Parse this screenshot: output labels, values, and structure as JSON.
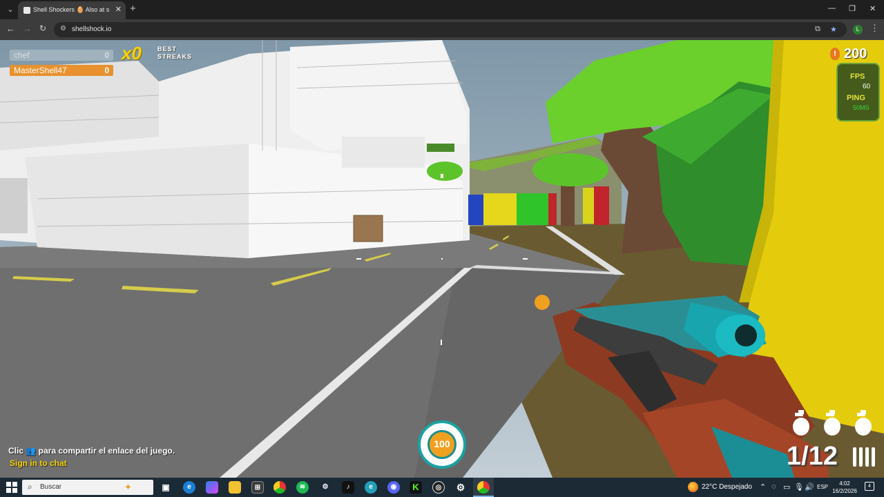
{
  "browser": {
    "tab_title": "Shell Shockers 🥚 Also at shell...",
    "tab_close": "✕",
    "new_tab": "+",
    "url": "shellshock.io",
    "profile_initial": "L",
    "window_controls": [
      "—",
      "❐",
      "✕"
    ]
  },
  "hud": {
    "scoreboard": [
      {
        "name": "chef",
        "score": "0"
      },
      {
        "name": "MasterShell47",
        "score": "0"
      }
    ],
    "streak_multiplier": "x0",
    "streak_label_line1": "BEST",
    "streak_label_line2": "STREAKS",
    "eggs_icon": "!",
    "eggs": "200",
    "fps_label": "FPS",
    "fps_value": "60",
    "ping_label": "PING",
    "ping_value": "50MS",
    "health": "100",
    "ammo": "1/12",
    "grenades": 3,
    "share_prefix": "Clic",
    "share_icon": "👥",
    "share_suffix": "para compartir el enlace del juego.",
    "sign_in": "Sign in to chat"
  },
  "colors": {
    "accent_orange": "#e8912e",
    "streak_yellow": "#f5d20a",
    "fps_yellow": "#e5e23b",
    "ping_green": "#3cd33c",
    "health_teal": "#1aa3a3"
  },
  "taskbar": {
    "search_placeholder": "Buscar",
    "weather": "22°C  Despejado",
    "language": "ESP",
    "time": "4:02",
    "date": "16/2/2026",
    "notification_count": "4",
    "apps": [
      "task-view",
      "edge",
      "copilot",
      "file-explorer",
      "store",
      "chrome",
      "spotify",
      "steam",
      "tiktok",
      "edge-canary",
      "discord",
      "kick",
      "obs",
      "settings",
      "chrome-active"
    ]
  }
}
